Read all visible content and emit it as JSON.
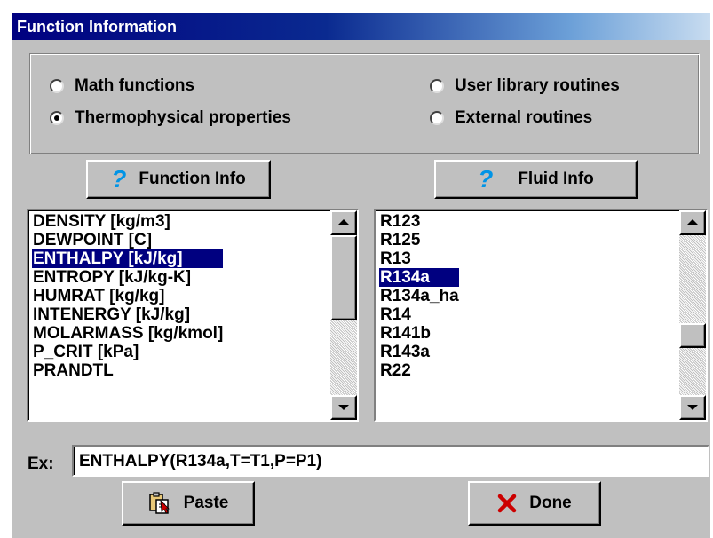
{
  "window": {
    "title": "Function Information"
  },
  "options": {
    "math": {
      "label": "Math functions",
      "selected": false
    },
    "thermo": {
      "label": "Thermophysical properties",
      "selected": true
    },
    "user_lib": {
      "label": "User library routines",
      "selected": false
    },
    "external": {
      "label": "External routines",
      "selected": false
    }
  },
  "buttons": {
    "function_info": "Function Info",
    "fluid_info": "Fluid Info",
    "paste": "Paste",
    "done": "Done"
  },
  "functions_list": {
    "items": [
      "DENSITY [kg/m3]",
      "DEWPOINT [C]",
      "ENTHALPY [kJ/kg]",
      "ENTROPY [kJ/kg-K]",
      "HUMRAT [kg/kg]",
      "INTENERGY [kJ/kg]",
      "MOLARMASS [kg/kmol]",
      "P_CRIT [kPa]",
      "PRANDTL"
    ],
    "selected_index": 2
  },
  "fluids_list": {
    "items": [
      "R123",
      "R125",
      "R13",
      "R134a",
      "R134a_ha",
      "R14",
      "R141b",
      "R143a",
      "R22"
    ],
    "selected_index": 3
  },
  "example": {
    "label": "Ex:",
    "value": "ENTHALPY(R134a,T=T1,P=P1)"
  },
  "icons": {
    "function_info": "question-mark-icon",
    "fluid_info": "question-mark-icon",
    "paste": "paste-icon",
    "done": "x-icon"
  },
  "colors": {
    "titlebar": "#000080",
    "selection": "#000080",
    "question_mark": "#0094e6",
    "done_x": "#cc0000"
  }
}
